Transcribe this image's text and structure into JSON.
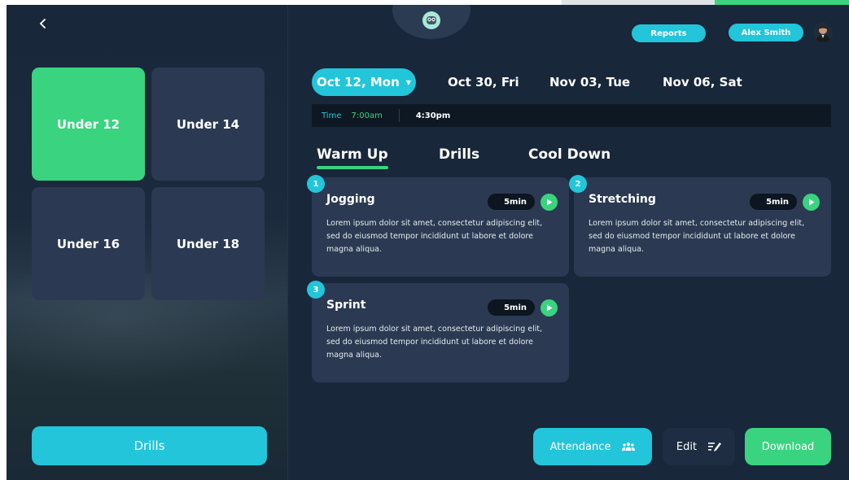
{
  "header": {
    "reports_label": "Reports",
    "user_name": "Alex Smith"
  },
  "age_groups": [
    {
      "label": "Under 12",
      "active": true
    },
    {
      "label": "Under 14",
      "active": false
    },
    {
      "label": "Under 16",
      "active": false
    },
    {
      "label": "Under 18",
      "active": false
    }
  ],
  "left_footer": {
    "drills_label": "Drills"
  },
  "dates": {
    "selected": "Oct 12, Mon",
    "others": [
      "Oct 30, Fri",
      "Nov 03, Tue",
      "Nov 06, Sat"
    ]
  },
  "time": {
    "label": "Time",
    "start": "7:00am",
    "end": "4:30pm"
  },
  "tabs": [
    {
      "label": "Warm Up",
      "active": true
    },
    {
      "label": "Drills",
      "active": false
    },
    {
      "label": "Cool Down",
      "active": false
    }
  ],
  "drills": [
    {
      "number": "1",
      "title": "Jogging",
      "duration": "5min",
      "description": "Lorem ipsum dolor sit amet, consectetur adipiscing elit, sed do eiusmod tempor incididunt ut labore et dolore magna aliqua."
    },
    {
      "number": "2",
      "title": "Stretching",
      "duration": "5min",
      "description": "Lorem ipsum dolor sit amet, consectetur adipiscing elit, sed do eiusmod tempor incididunt ut labore et dolore magna aliqua."
    },
    {
      "number": "3",
      "title": "Sprint",
      "duration": "5min",
      "description": "Lorem ipsum dolor sit amet, consectetur adipiscing elit, sed do eiusmod tempor incididunt ut labore et dolore magna aliqua."
    }
  ],
  "actions": {
    "attendance_label": "Attendance",
    "edit_label": "Edit",
    "download_label": "Download"
  },
  "icons": {
    "back": "chevron-left-icon",
    "logo": "owl-logo-icon",
    "play": "play-icon",
    "attendance": "people-group-icon",
    "edit": "pencil-note-icon"
  },
  "colors": {
    "background": "#18273a",
    "card": "#2b3a52",
    "accent_cyan": "#22c5d9",
    "accent_green": "#3ad37f"
  }
}
